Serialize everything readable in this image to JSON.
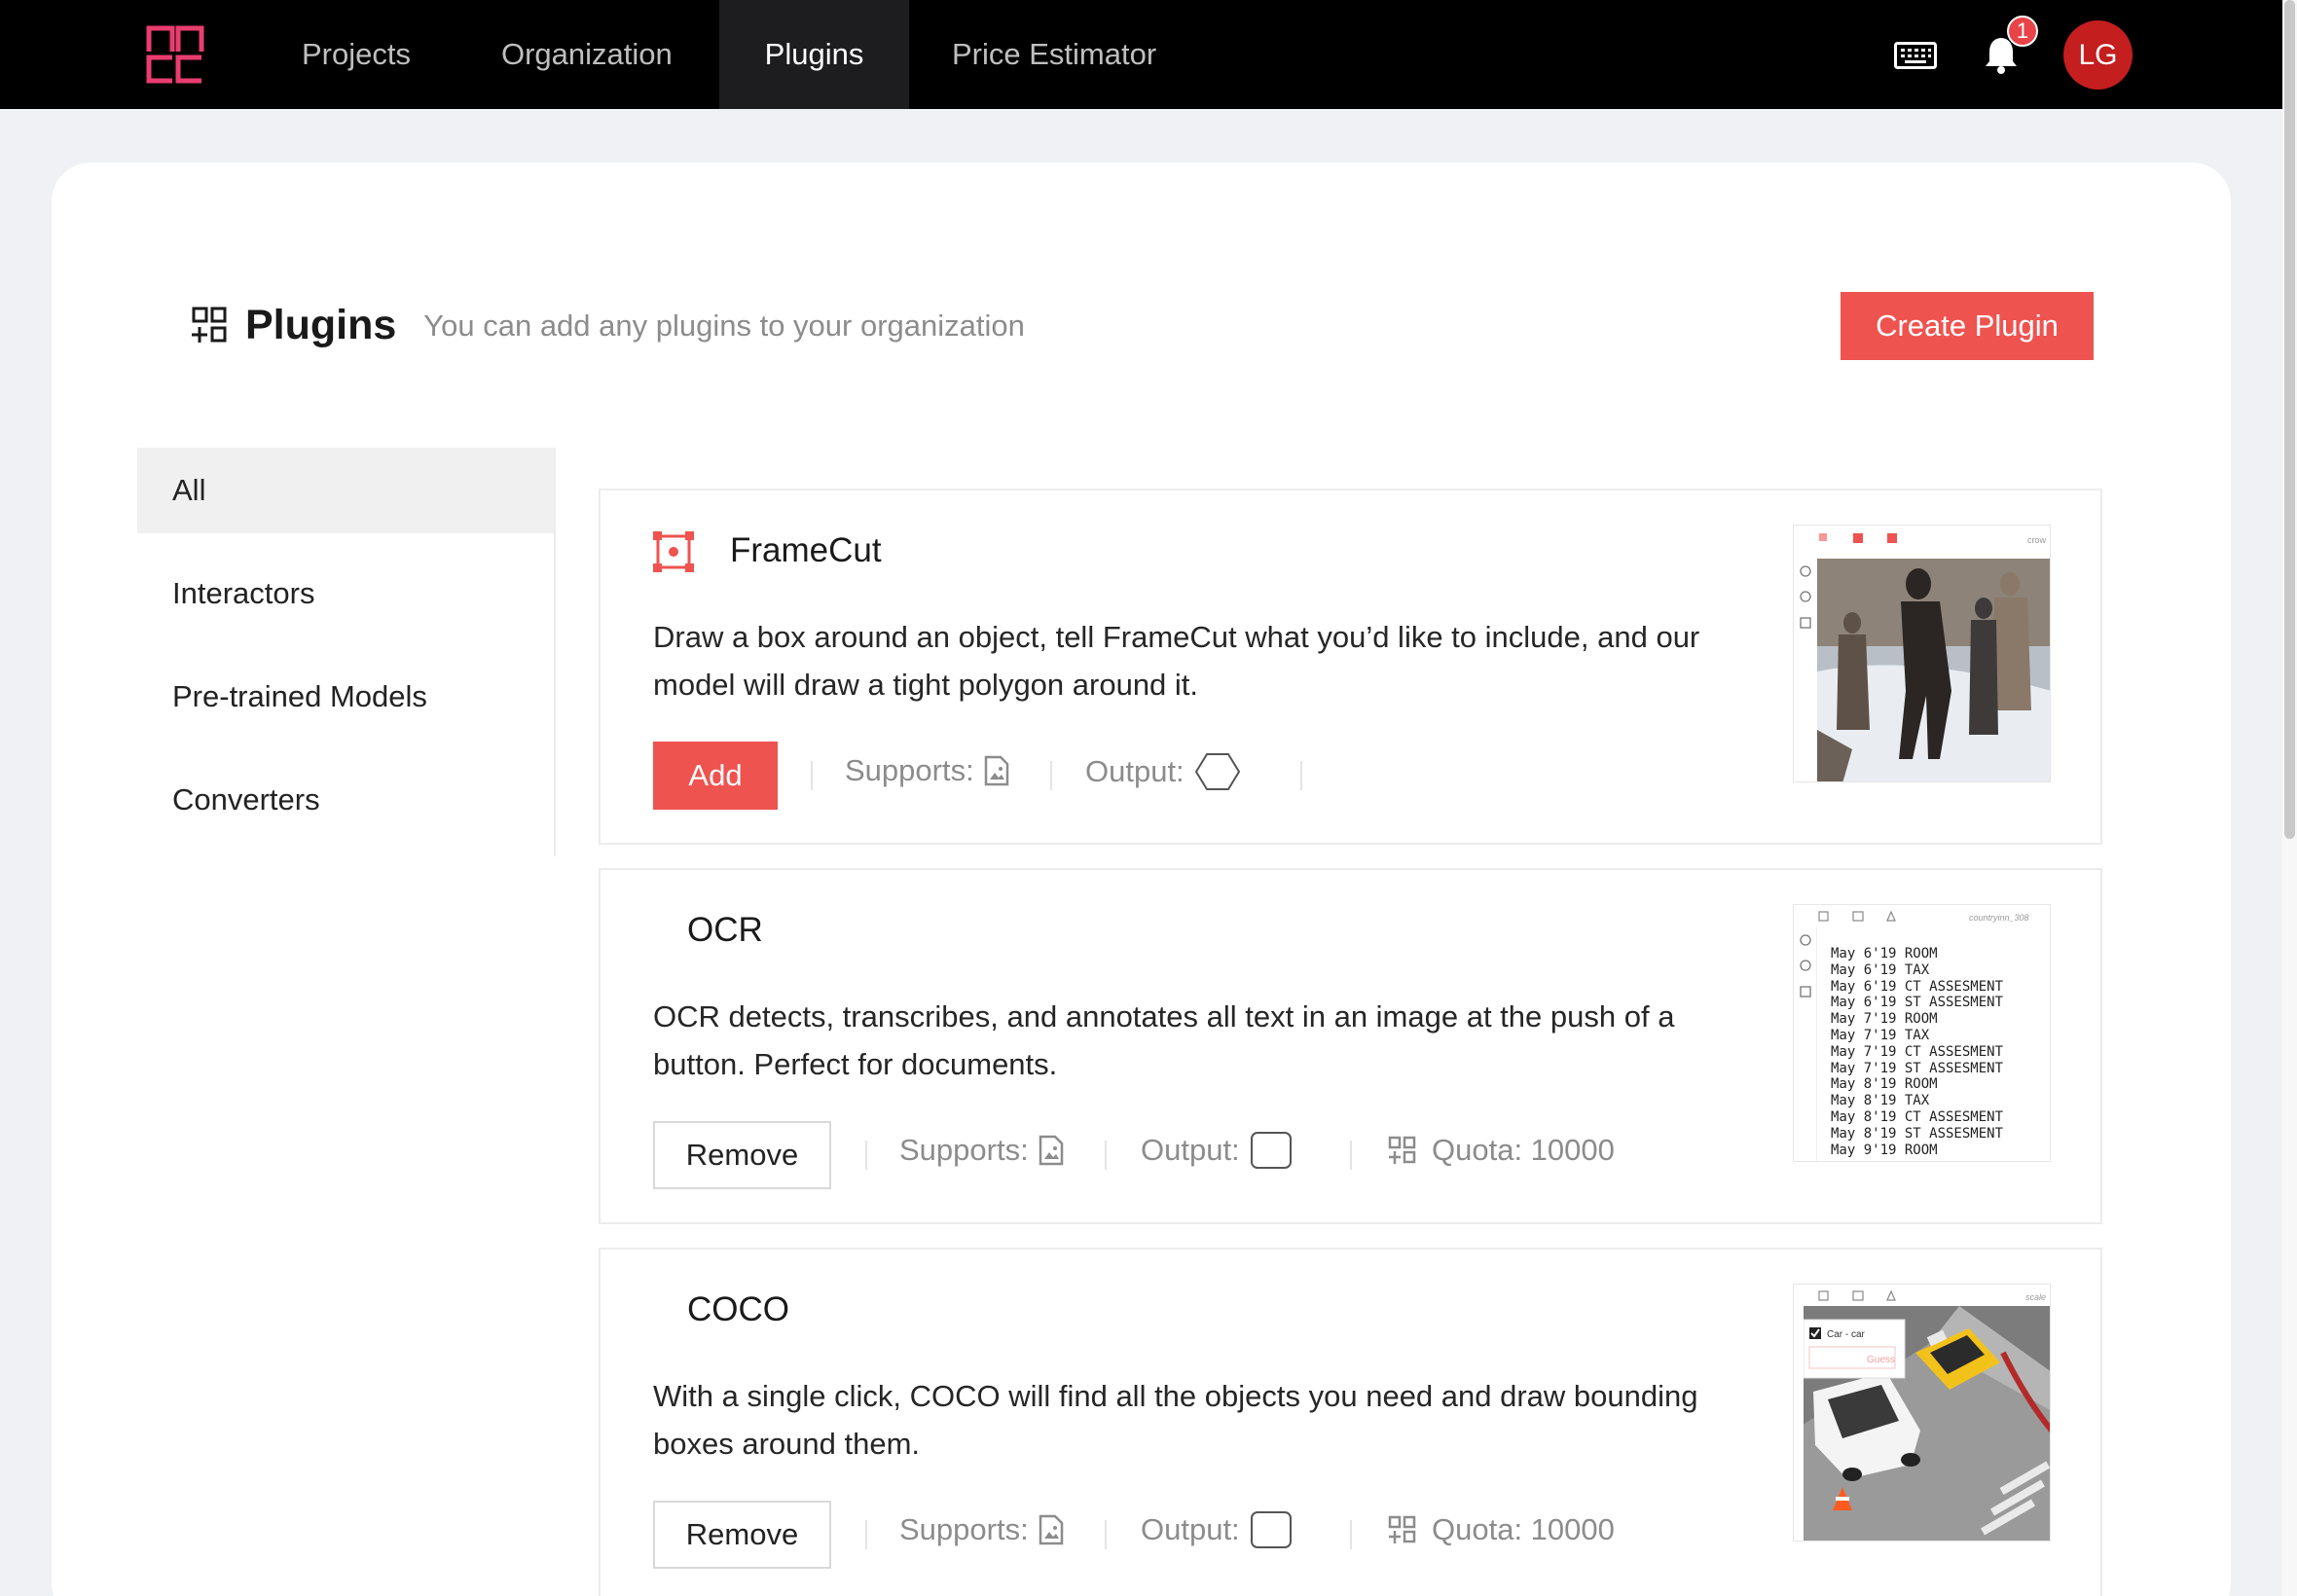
{
  "nav": {
    "tabs": [
      {
        "label": "Projects"
      },
      {
        "label": "Organization"
      },
      {
        "label": "Plugins",
        "active": true
      },
      {
        "label": "Price Estimator"
      }
    ],
    "notification_count": "1",
    "avatar_initials": "LG"
  },
  "page": {
    "title": "Plugins",
    "subtitle": "You can add any plugins to your organization",
    "create_button": "Create Plugin"
  },
  "sidebar": {
    "items": [
      {
        "label": "All",
        "active": true
      },
      {
        "label": "Interactors"
      },
      {
        "label": "Pre-trained Models"
      },
      {
        "label": "Converters"
      }
    ]
  },
  "plugins": [
    {
      "name": "FrameCut",
      "description": "Draw a box around an object, tell FrameCut what you’d like to include, and our model will draw a tight polygon around it.",
      "action": "Add",
      "supports_label": "Supports:",
      "output_label": "Output:",
      "thumb_caption": "crow"
    },
    {
      "name": "OCR",
      "description": "OCR detects, transcribes, and annotates all text in an image at the push of a button. Perfect for documents.",
      "action": "Remove",
      "supports_label": "Supports:",
      "output_label": "Output:",
      "quota": "Quota: 10000",
      "thumb_caption": "countryinn_308",
      "ocr_text": "May 6'19 ROOM\nMay 6'19 TAX\nMay 6'19 CT ASSESMENT\nMay 6'19 ST ASSESMENT\nMay 7'19 ROOM\nMay 7'19 TAX\nMay 7'19 CT ASSESMENT\nMay 7'19 ST ASSESMENT\nMay 8'19 ROOM\nMay 8'19 TAX\nMay 8'19 CT ASSESMENT\nMay 8'19 ST ASSESMENT\nMay 9'19 ROOM"
    },
    {
      "name": "COCO",
      "description": "With a single click, COCO will find all the objects you need and draw bounding boxes around them.",
      "action": "Remove",
      "supports_label": "Supports:",
      "output_label": "Output:",
      "quota": "Quota: 10000",
      "thumb_caption": "scale",
      "popup_label": "Car - car",
      "popup_guess": "Guess"
    }
  ],
  "colors": {
    "accent": "#ef5350",
    "logo": "#ea3d6f",
    "nav_bg": "#000000",
    "avatar": "#c41e1e"
  },
  "icons": [
    "logo-icon",
    "keyboard-icon",
    "bell-icon",
    "plugins-grid-icon",
    "framecut-icon",
    "image-file-icon",
    "polygon-icon",
    "rectangle-icon",
    "quota-grid-icon"
  ]
}
